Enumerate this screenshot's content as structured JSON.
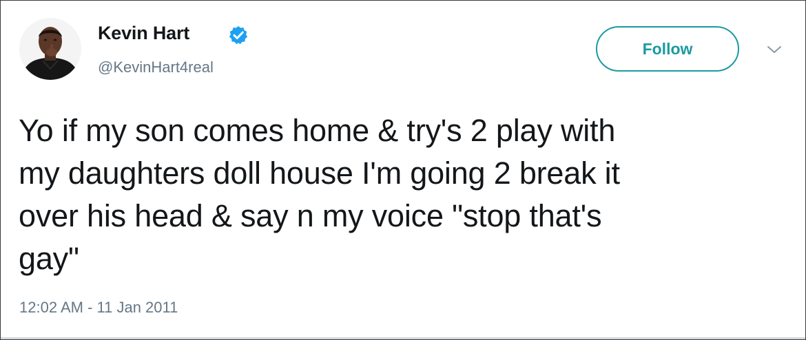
{
  "tweet": {
    "author": {
      "name": "Kevin Hart",
      "handle": "@KevinHart4real",
      "verified": true,
      "avatar_icon": "profile-photo"
    },
    "follow_label": "Follow",
    "text": "Yo if my son comes home & try's 2 play with\nmy daughters doll house I'm going 2 break it\nover his head & say n my voice \"stop that's\ngay\"",
    "timestamp": "12:02 AM - 11 Jan 2011"
  },
  "colors": {
    "accent": "#1b9aa0",
    "verified_badge": "#1da1f2",
    "text_primary": "#14171a",
    "text_secondary": "#657786"
  }
}
